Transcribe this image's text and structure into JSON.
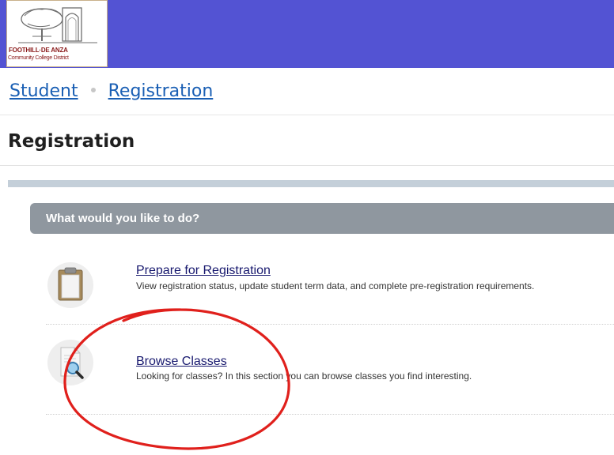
{
  "header": {
    "logo": {
      "line1": "FOOTHILL·DE ANZA",
      "line2": "Community College District"
    },
    "bar_color": "#5353d3"
  },
  "breadcrumb": {
    "items": [
      "Student",
      "Registration"
    ]
  },
  "page_title": "Registration",
  "section": {
    "header": "What would you like to do?",
    "options": [
      {
        "title": "Prepare for Registration",
        "description": "View registration status, update student term data, and complete pre-registration requirements.",
        "icon": "clipboard-icon"
      },
      {
        "title": "Browse Classes",
        "description": "Looking for classes? In this section you can browse classes you find interesting.",
        "icon": "magnifier-document-icon"
      }
    ]
  },
  "annotation": {
    "shape": "circle",
    "color": "#e0201c"
  }
}
